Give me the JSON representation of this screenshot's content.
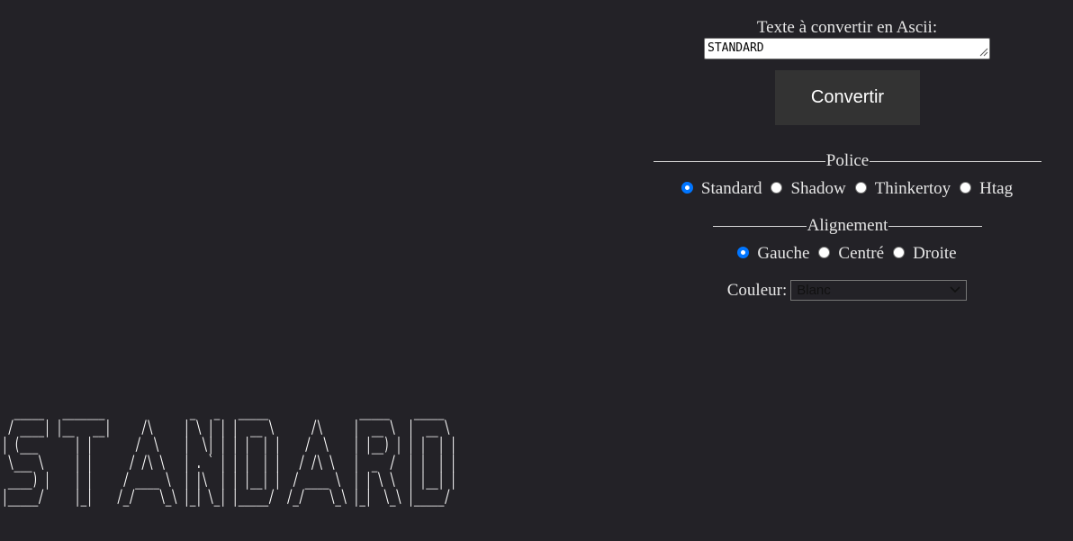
{
  "converter": {
    "label": "Texte à convertir en Ascii:",
    "input_value": "STANDARD",
    "convert_label": "Convertir"
  },
  "font_section": {
    "title": "Police",
    "options": [
      {
        "label": "Standard",
        "checked": true
      },
      {
        "label": "Shadow",
        "checked": false
      },
      {
        "label": "Thinkertoy",
        "checked": false
      },
      {
        "label": "Htag",
        "checked": false
      }
    ]
  },
  "align_section": {
    "title": "Alignement",
    "options": [
      {
        "label": "Gauche",
        "checked": true
      },
      {
        "label": "Centré",
        "checked": false
      },
      {
        "label": "Droite",
        "checked": false
      }
    ]
  },
  "color": {
    "label": "Couleur:",
    "selected": "Blanc"
  },
  "ascii_art": {
    "text": "  _____   _______              _   _   _____               _____    _____  \n / ____| |__   __|     /\\     | \\ | | |  __ \\      /\\     |  __ \\  |  __ \\ \n| (___      | |       /  \\    |  \\| | | |  | |    /  \\    | |__) | | |  | |\n \\___ \\     | |      / /\\ \\   | . ` | | |  | |   / /\\ \\   |  _  /  | |  | |\n ____) |    | |     / ____ \\  | |\\  | | |__| |  / ____ \\  | | \\ \\  | |__| |\n|_____/     |_|    /_/    \\_\\ |_| \\_| |_____/  /_/    \\_\\ |_|  \\_\\ |_____/ \n                                                                            \n                                                                            "
  },
  "colors": {
    "background": "#232227",
    "button_bg": "#333333",
    "radio_accent": "#0075ff",
    "text": "#e6e6e6"
  }
}
